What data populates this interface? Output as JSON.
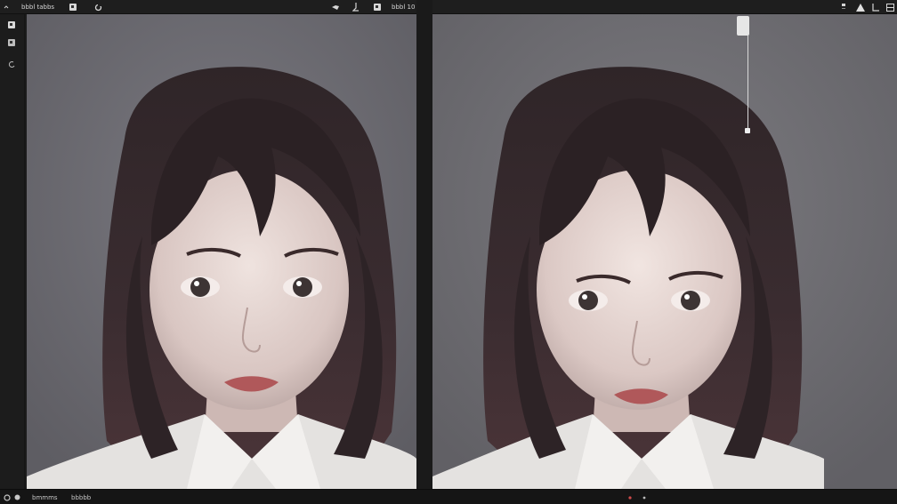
{
  "toolbar": {
    "title": "bbbl tabbs",
    "zoom_label": "bbbl 10"
  },
  "statusbar": {
    "left_label": "bmmms",
    "right_label": "bbbbb"
  },
  "icons": {
    "menu": "chevron-icon",
    "image": "image-icon",
    "refresh": "refresh-icon",
    "pen": "pen-icon",
    "brush": "brush-icon",
    "warning": "warning-icon",
    "layers": "layers-icon",
    "crop": "crop-icon"
  },
  "colors": {
    "background": "#6d6c73",
    "hair": "#2a2224",
    "skin": "#d8c6c2",
    "lips": "#b0585a",
    "shirt": "#e4e2e0",
    "chrome": "#1e1e1e"
  }
}
